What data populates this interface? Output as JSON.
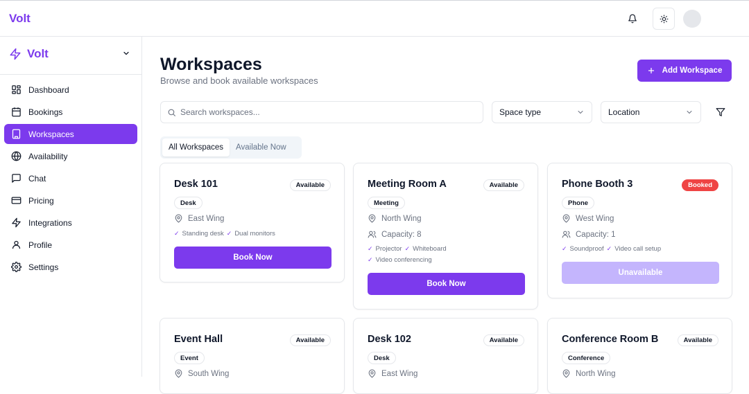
{
  "topbar": {
    "brand": "Volt"
  },
  "sidebar": {
    "brand": "Volt",
    "items": [
      {
        "label": "Dashboard",
        "icon": "dashboard-icon"
      },
      {
        "label": "Bookings",
        "icon": "calendar-icon"
      },
      {
        "label": "Workspaces",
        "icon": "building-icon",
        "active": true
      },
      {
        "label": "Availability",
        "icon": "globe-icon"
      },
      {
        "label": "Chat",
        "icon": "chat-icon"
      },
      {
        "label": "Pricing",
        "icon": "credit-card-icon"
      },
      {
        "label": "Integrations",
        "icon": "zap-icon"
      },
      {
        "label": "Profile",
        "icon": "user-icon"
      },
      {
        "label": "Settings",
        "icon": "gear-icon"
      }
    ]
  },
  "main": {
    "title": "Workspaces",
    "subtitle": "Browse and book available workspaces",
    "add_label": "Add Workspace",
    "search": {
      "placeholder": "Search workspaces...",
      "value": ""
    },
    "filters": {
      "space_type": "Space type",
      "location": "Location"
    },
    "tabs": [
      {
        "label": "All Workspaces",
        "active": true
      },
      {
        "label": "Available Now"
      }
    ],
    "cards": [
      {
        "name": "Desk 101",
        "status": "Available",
        "type": "Desk",
        "location": "East Wing",
        "features": [
          [
            "Standing desk",
            "Dual monitors"
          ]
        ],
        "action": "Book Now"
      },
      {
        "name": "Meeting Room A",
        "status": "Available",
        "type": "Meeting",
        "location": "North Wing",
        "capacity": "Capacity: 8",
        "features": [
          [
            "Projector",
            "Whiteboard"
          ],
          [
            "Video conferencing"
          ]
        ],
        "action": "Book Now"
      },
      {
        "name": "Phone Booth 3",
        "status": "Booked",
        "type": "Phone",
        "location": "West Wing",
        "capacity": "Capacity: 1",
        "features": [
          [
            "Soundproof",
            "Video call setup"
          ]
        ],
        "action": "Unavailable"
      },
      {
        "name": "Event Hall",
        "status": "Available",
        "type": "Event",
        "location": "South Wing"
      },
      {
        "name": "Desk 102",
        "status": "Available",
        "type": "Desk",
        "location": "East Wing"
      },
      {
        "name": "Conference Room B",
        "status": "Available",
        "type": "Conference",
        "location": "North Wing"
      }
    ]
  },
  "colors": {
    "accent": "#7c3aed",
    "booked": "#ef4444",
    "disabled": "#c4b5fd"
  }
}
